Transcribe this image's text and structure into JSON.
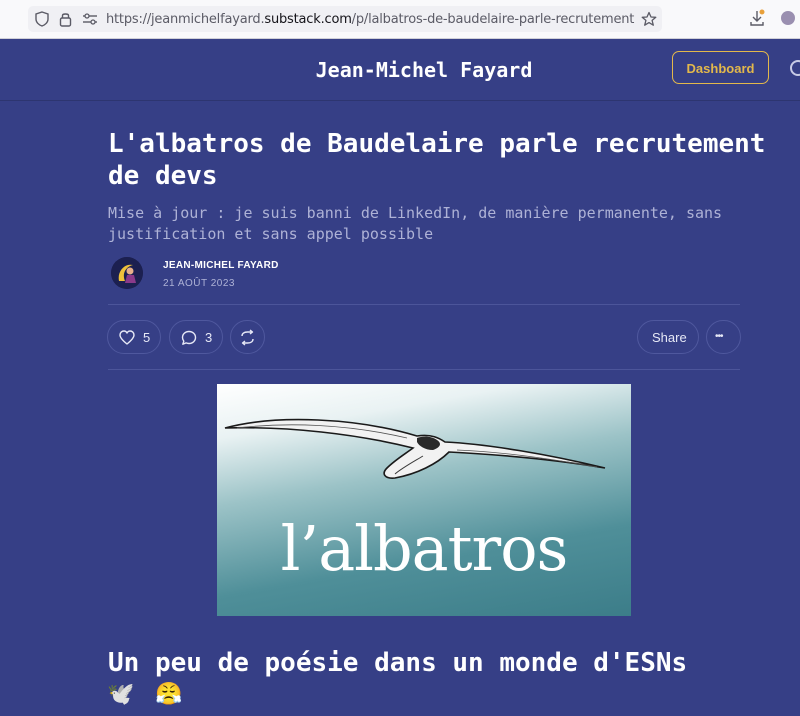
{
  "browser": {
    "url_prefix": "https://jeanmichelfayard.",
    "url_domain": "substack.com",
    "url_path": "/p/lalbatros-de-baudelaire-parle-recrutement"
  },
  "header": {
    "site_title": "Jean-Michel Fayard",
    "dashboard_label": "Dashboard"
  },
  "post": {
    "title": "L'albatros de Baudelaire parle recrutement de devs",
    "subtitle": "Mise à jour : je suis banni de LinkedIn, de manière permanente, sans justification et sans appel possible",
    "author": "JEAN-MICHEL FAYARD",
    "date": "21 AOÛT 2023"
  },
  "actions": {
    "likes": "5",
    "comments": "3",
    "share_label": "Share",
    "more_glyph": "•••"
  },
  "hero": {
    "caption": "l’albatros"
  },
  "section": {
    "heading": "Un peu de poésie dans un monde d'ESNs",
    "emoji_1": "🕊️",
    "emoji_2": "😤"
  },
  "colors": {
    "background": "#363f86",
    "accent": "#e3b84b",
    "text": "#ffffff",
    "muted": "#aeb2d6"
  },
  "icons": [
    "shield-icon",
    "lock-icon",
    "permissions-icon",
    "star-icon",
    "download-icon",
    "profile-icon",
    "search-icon",
    "heart-icon",
    "comment-icon",
    "restack-icon",
    "more-icon"
  ]
}
